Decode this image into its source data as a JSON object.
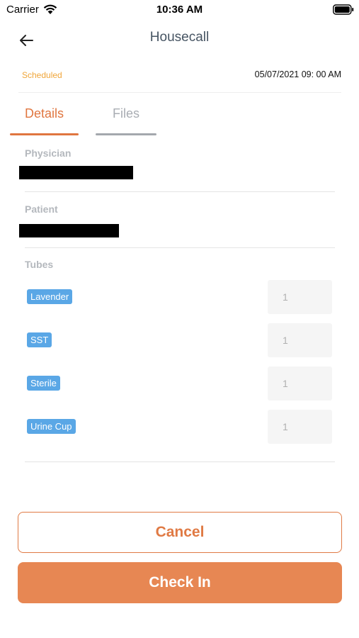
{
  "status_bar": {
    "carrier": "Carrier",
    "time": "10:36 AM"
  },
  "nav": {
    "title": "Housecall",
    "back_icon": "arrow-left-icon"
  },
  "appointment": {
    "status": "Scheduled",
    "datetime": "05/07/2021 09: 00 AM"
  },
  "tabs": [
    {
      "label": "Details",
      "active": true
    },
    {
      "label": "Files",
      "active": false
    }
  ],
  "details": {
    "physician_label": "Physician",
    "patient_label": "Patient",
    "tubes_label": "Tubes",
    "tubes": [
      {
        "name": "Lavender",
        "quantity": "1"
      },
      {
        "name": "SST",
        "quantity": "1"
      },
      {
        "name": "Sterile",
        "quantity": "1"
      },
      {
        "name": "Urine Cup",
        "quantity": "1"
      }
    ]
  },
  "actions": {
    "cancel_label": "Cancel",
    "checkin_label": "Check In"
  },
  "colors": {
    "accent": "#e07640",
    "status_scheduled": "#f0a63a",
    "tube_tag": "#5aa7e6",
    "checkin_bg": "#e78753"
  }
}
